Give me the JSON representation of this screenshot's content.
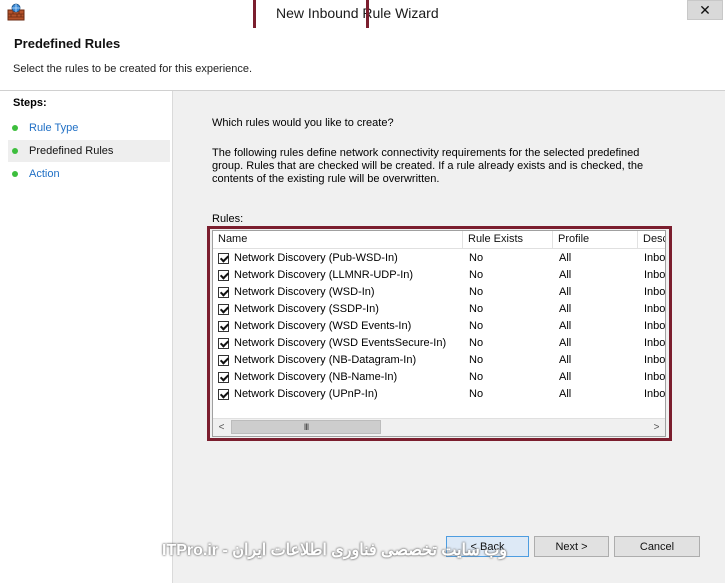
{
  "window": {
    "title": "New Inbound Rule Wizard",
    "close_label": "✕"
  },
  "header": {
    "title": "Predefined Rules",
    "subtitle": "Select the rules to be created for this experience."
  },
  "sidebar": {
    "steps_title": "Steps:",
    "items": [
      {
        "label": "Rule Type",
        "state": "link"
      },
      {
        "label": "Predefined Rules",
        "state": "current"
      },
      {
        "label": "Action",
        "state": "link"
      }
    ]
  },
  "main": {
    "question": "Which rules would you like to create?",
    "description": "The following rules define network connectivity requirements for the selected predefined group. Rules that are checked will be created. If a rule already exists and is checked, the contents of the existing rule will be overwritten.",
    "rules_label": "Rules:"
  },
  "rules_table": {
    "columns": [
      "Name",
      "Rule Exists",
      "Profile",
      "Desc"
    ],
    "rows": [
      {
        "checked": true,
        "name": "Network Discovery (Pub-WSD-In)",
        "exists": "No",
        "profile": "All",
        "desc": "Inbou"
      },
      {
        "checked": true,
        "name": "Network Discovery (LLMNR-UDP-In)",
        "exists": "No",
        "profile": "All",
        "desc": "Inbou"
      },
      {
        "checked": true,
        "name": "Network Discovery (WSD-In)",
        "exists": "No",
        "profile": "All",
        "desc": "Inbou"
      },
      {
        "checked": true,
        "name": "Network Discovery (SSDP-In)",
        "exists": "No",
        "profile": "All",
        "desc": "Inbou"
      },
      {
        "checked": true,
        "name": "Network Discovery (WSD Events-In)",
        "exists": "No",
        "profile": "All",
        "desc": "Inbou"
      },
      {
        "checked": true,
        "name": "Network Discovery (WSD EventsSecure-In)",
        "exists": "No",
        "profile": "All",
        "desc": "Inbou"
      },
      {
        "checked": true,
        "name": "Network Discovery (NB-Datagram-In)",
        "exists": "No",
        "profile": "All",
        "desc": "Inbou"
      },
      {
        "checked": true,
        "name": "Network Discovery (NB-Name-In)",
        "exists": "No",
        "profile": "All",
        "desc": "Inbou"
      },
      {
        "checked": true,
        "name": "Network Discovery (UPnP-In)",
        "exists": "No",
        "profile": "All",
        "desc": "Inbou"
      }
    ],
    "scroll_left": "<",
    "scroll_right": ">",
    "scroll_grip": "III"
  },
  "buttons": {
    "back": "< Back",
    "next": "Next >",
    "cancel": "Cancel"
  },
  "watermark": "وب سایت تخصصی فناوری اطلاعات ایران - ITPro.ir",
  "colors": {
    "highlight": "#7b1e2e",
    "link": "#1f6fc5",
    "step_dot": "#3dbe3d",
    "panel_bg": "#f0f0f0"
  }
}
